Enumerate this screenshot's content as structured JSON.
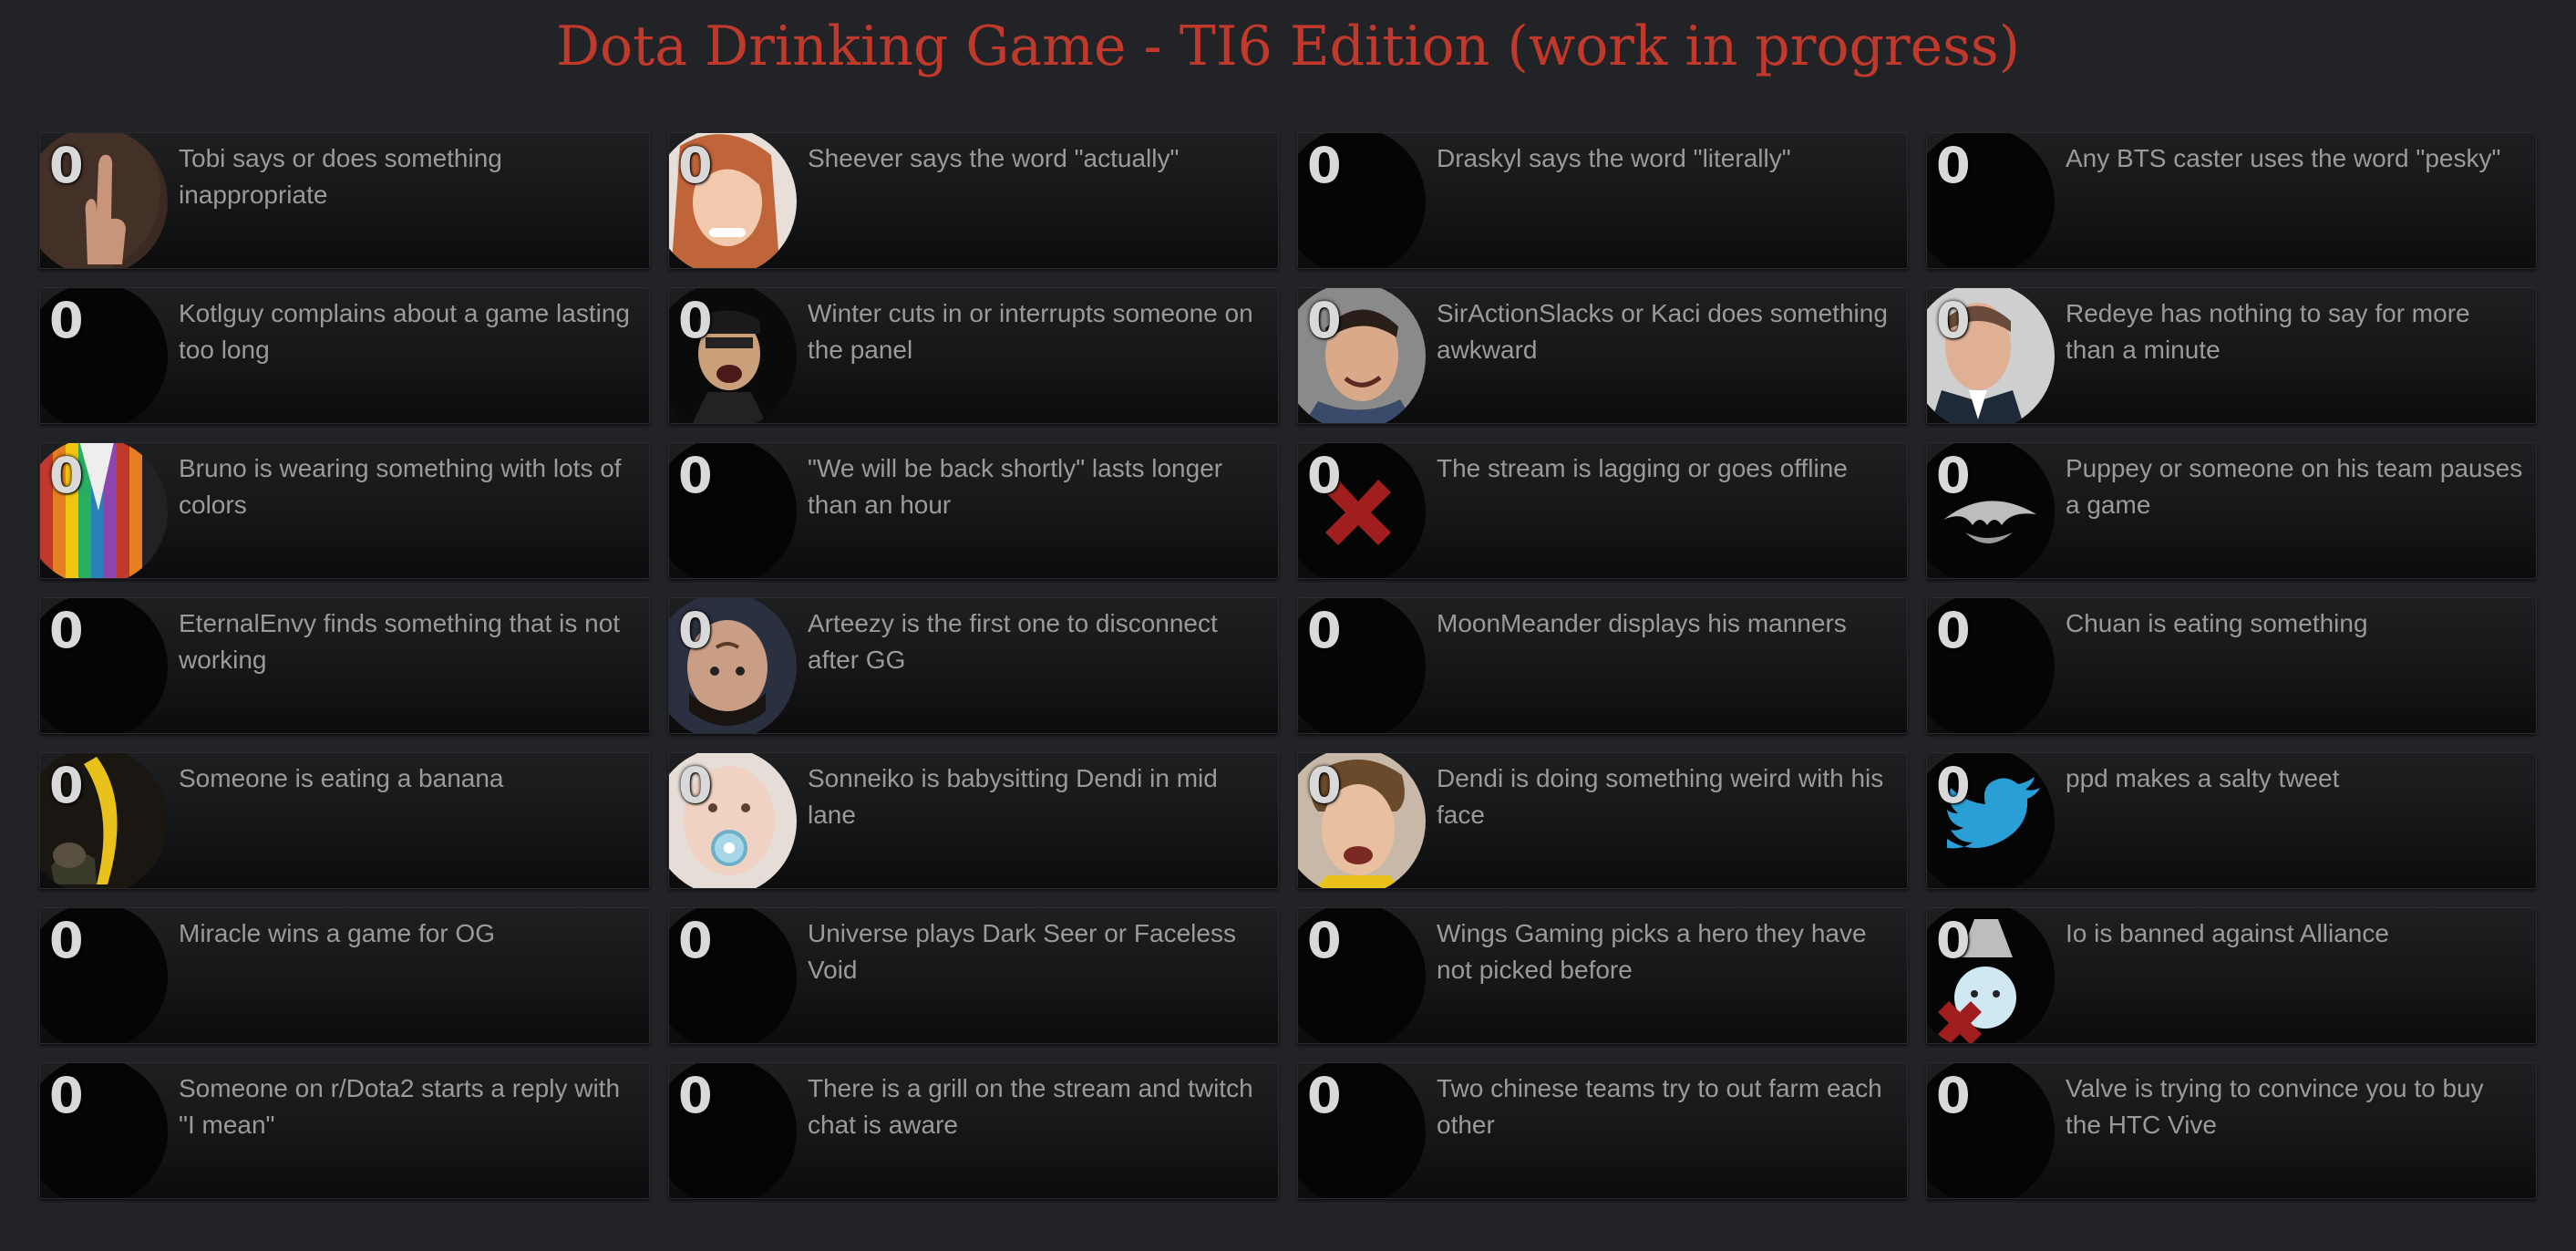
{
  "title": "Dota Drinking Game - TI6 Edition (work in progress)",
  "colors": {
    "background": "#222327",
    "title": "#c0392b",
    "counter": "#d9d9d9",
    "text": "#9a9a9a"
  },
  "tiles": [
    {
      "count": "0",
      "text": "Tobi says or does something inappropriate",
      "icon": "middle-finger-hand-icon"
    },
    {
      "count": "0",
      "text": "Sheever says the word \"actually\"",
      "icon": "sheever-portrait-icon"
    },
    {
      "count": "0",
      "text": "Draskyl says the word \"literally\"",
      "icon": "blank-portrait-icon"
    },
    {
      "count": "0",
      "text": "Any BTS caster uses the word \"pesky\"",
      "icon": "blank-portrait-icon"
    },
    {
      "count": "0",
      "text": "Kotlguy complains about a game lasting too long",
      "icon": "blank-portrait-icon"
    },
    {
      "count": "0",
      "text": "Winter cuts in or interrupts someone on the panel",
      "icon": "winter-portrait-icon"
    },
    {
      "count": "0",
      "text": "SirActionSlacks or Kaci does something awkward",
      "icon": "slacks-portrait-icon"
    },
    {
      "count": "0",
      "text": "Redeye has nothing to say for more than a minute",
      "icon": "redeye-portrait-icon"
    },
    {
      "count": "0",
      "text": "Bruno is wearing something with lots of colors",
      "icon": "striped-jacket-icon"
    },
    {
      "count": "0",
      "text": "\"We will be back shortly\" lasts longer than an hour",
      "icon": "blank-portrait-icon"
    },
    {
      "count": "0",
      "text": "The stream is lagging or goes offline",
      "icon": "red-x-icon"
    },
    {
      "count": "0",
      "text": "Puppey or someone on his team pauses a game",
      "icon": "team-secret-logo-icon"
    },
    {
      "count": "0",
      "text": "EternalEnvy finds something that is not working",
      "icon": "blank-portrait-icon"
    },
    {
      "count": "0",
      "text": "Arteezy is the first one to disconnect after GG",
      "icon": "arteezy-portrait-icon"
    },
    {
      "count": "0",
      "text": "MoonMeander displays his manners",
      "icon": "blank-portrait-icon"
    },
    {
      "count": "0",
      "text": "Chuan is eating something",
      "icon": "blank-portrait-icon"
    },
    {
      "count": "0",
      "text": "Someone is eating a banana",
      "icon": "banana-icon"
    },
    {
      "count": "0",
      "text": "Sonneiko is babysitting Dendi in mid lane",
      "icon": "baby-pacifier-icon"
    },
    {
      "count": "0",
      "text": "Dendi is doing something weird with his face",
      "icon": "dendi-portrait-icon"
    },
    {
      "count": "0",
      "text": "ppd makes a salty tweet",
      "icon": "twitter-bird-icon"
    },
    {
      "count": "0",
      "text": "Miracle wins a game for OG",
      "icon": "blank-portrait-icon"
    },
    {
      "count": "0",
      "text": "Universe plays Dark Seer or Faceless Void",
      "icon": "blank-portrait-icon"
    },
    {
      "count": "0",
      "text": "Wings Gaming picks a hero they have not picked before",
      "icon": "blank-portrait-icon"
    },
    {
      "count": "0",
      "text": "Io is banned against Alliance",
      "icon": "io-banned-icon"
    },
    {
      "count": "0",
      "text": "Someone on r/Dota2 starts a reply with \"I mean\"",
      "icon": "blank-portrait-icon"
    },
    {
      "count": "0",
      "text": "There is a grill on the stream and twitch chat is aware",
      "icon": "blank-portrait-icon"
    },
    {
      "count": "0",
      "text": "Two chinese teams try to out farm each other",
      "icon": "blank-portrait-icon"
    },
    {
      "count": "0",
      "text": "Valve is trying to convince you to buy the HTC Vive",
      "icon": "blank-portrait-icon"
    }
  ]
}
